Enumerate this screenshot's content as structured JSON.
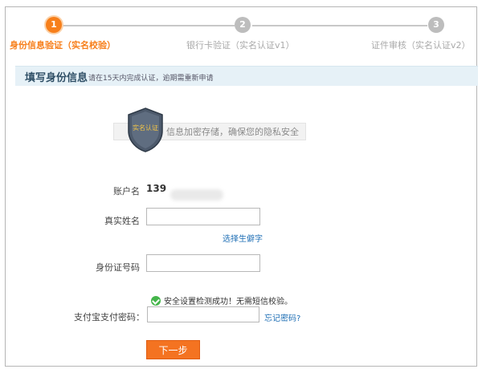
{
  "steps": [
    {
      "num": "1",
      "label": "身份信息验证（实名校验）"
    },
    {
      "num": "2",
      "label": "银行卡验证（实名认证v1）"
    },
    {
      "num": "3",
      "label": "证件审核（实名认证v2）"
    }
  ],
  "section": {
    "title": "填写身份信息",
    "note": "请在15天内完成认证，逾期需重新申请"
  },
  "banner": {
    "text": "信息加密存储，确保您的隐私安全",
    "shield_text": "实名认证"
  },
  "form": {
    "account_label": "账户名",
    "account_value": "139",
    "realname_label": "真实姓名",
    "rare_char_link": "选择生僻字",
    "idcard_label": "身份证号码",
    "notice": "安全设置检测成功！无需短信校验。",
    "paypwd_label": "支付宝支付密码：",
    "forgot_link": "忘记密码?",
    "next_button": "下一步"
  },
  "colors": {
    "accent": "#f47321",
    "link": "#1f6fb5",
    "success": "#44b54a"
  }
}
